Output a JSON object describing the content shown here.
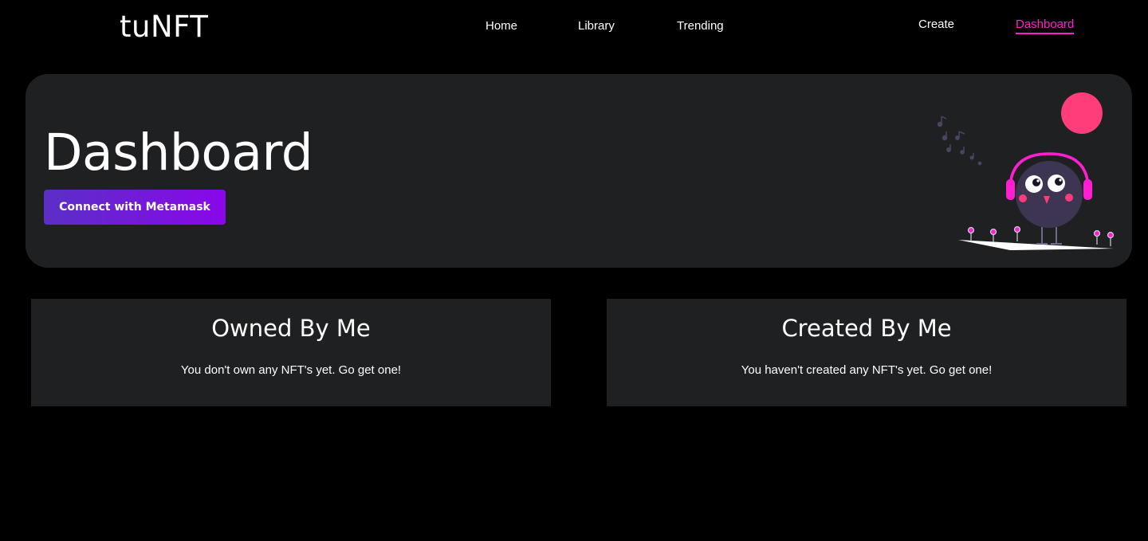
{
  "header": {
    "logo": "tuNFT",
    "nav": {
      "home": "Home",
      "library": "Library",
      "trending": "Trending",
      "create": "Create",
      "dashboard": "Dashboard"
    },
    "active_color": "#ff1fd1"
  },
  "hero": {
    "title": "Dashboard",
    "connect_label": "Connect with Metamask",
    "illustration": "headphones-bird-illustration"
  },
  "cards": {
    "owned": {
      "title": "Owned By Me",
      "empty_text": "You don't own any NFT's yet. Go get one!"
    },
    "created": {
      "title": "Created By Me",
      "empty_text": "You haven't created any NFT's yet. Go get one!"
    }
  },
  "colors": {
    "background": "#000000",
    "panel": "#1f2022",
    "accent": "#ff1fd1",
    "button_gradient_start": "#5a2fc6",
    "button_gradient_end": "#8a07ea"
  }
}
